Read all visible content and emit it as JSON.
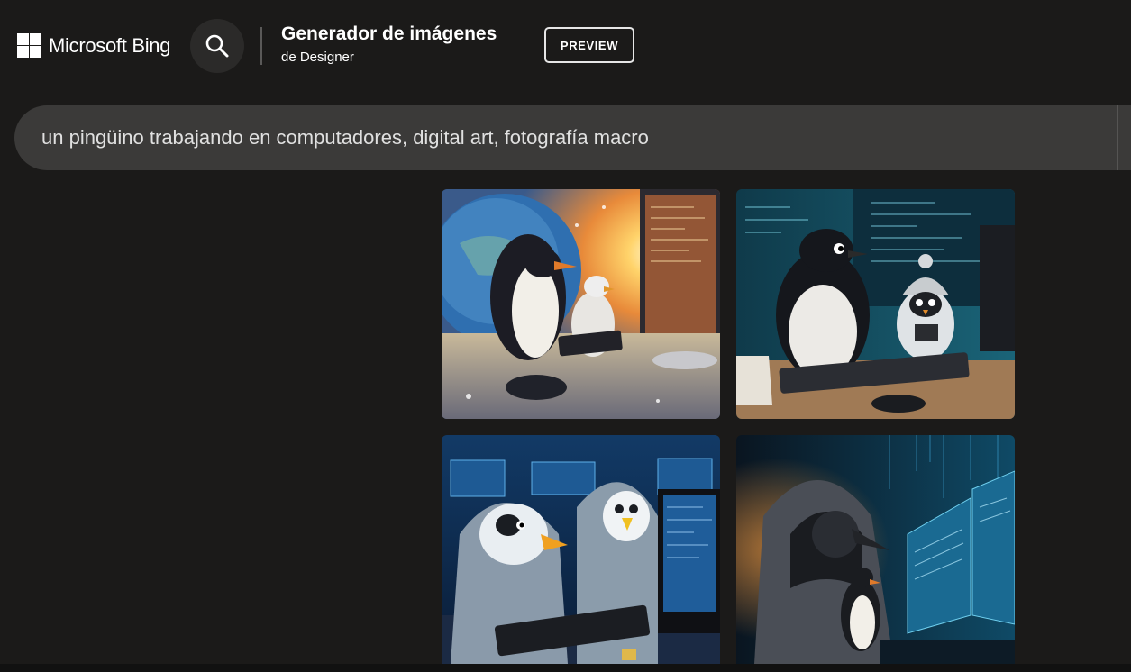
{
  "header": {
    "brand_name": "Microsoft Bing",
    "title": "Generador de imágenes",
    "subtitle": "de Designer",
    "preview_label": "PREVIEW"
  },
  "icons": {
    "logo": "microsoft-grid-icon",
    "search": "search-icon"
  },
  "prompt": {
    "value": "un pingüino trabajando en computadores, digital art, fotografía macro"
  },
  "results": {
    "images": [
      {
        "subject": "penguin and chick at computer keyboard, earth and sunlight background"
      },
      {
        "subject": "penguin and small penguin in knit hat at keyboard, code screens"
      },
      {
        "subject": "two hooded penguins typing at computers, blue monitors"
      },
      {
        "subject": "hooded penguin with small penguin, cyberpunk code screens"
      }
    ]
  },
  "colors": {
    "background": "#1b1a19",
    "prompt_bar": "#3b3a39",
    "search_button": "#2b2a29",
    "text": "#ffffff"
  }
}
